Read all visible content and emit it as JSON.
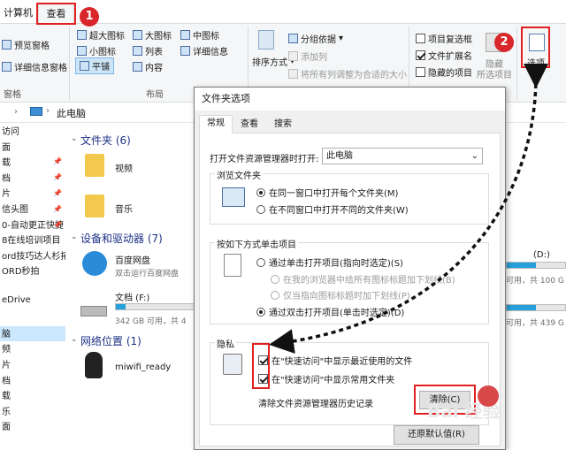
{
  "tabs": {
    "computer": "计算机",
    "view": "查看"
  },
  "markers": {
    "one": "1",
    "two": "2"
  },
  "ribbon": {
    "pane": {
      "preview": "预览窗格",
      "details": "详细信息窗格",
      "group": "窗格"
    },
    "layout": {
      "xl": "超大图标",
      "large": "大图标",
      "medium": "中图标",
      "small": "小图标",
      "list": "列表",
      "details": "详细信息",
      "tiles": "平铺",
      "content": "内容",
      "group": "布局"
    },
    "view": {
      "sort": "排序方式",
      "group_by": "分组依据",
      "add_col": "添加列",
      "fit": "将所有列调整为合适的大小"
    },
    "show": {
      "checkbox": "项目复选框",
      "ext": "文件扩展名",
      "hidden": "隐藏的项目",
      "hide": "隐藏",
      "selected": "所选项目"
    },
    "options": "选项"
  },
  "address": {
    "path": "此电脑"
  },
  "nav": [
    "访问",
    "面",
    "载",
    "档",
    "片",
    "信头图",
    "0-自动更正快捷",
    "8在线培训项目",
    "ord技巧达人杉拓",
    "ORD秒拍",
    "",
    "eDrive",
    "",
    "脑",
    "频",
    "片",
    "档",
    "载",
    "乐",
    "面"
  ],
  "content": {
    "folders_header": "文件夹 (6)",
    "folders": [
      "视频",
      "音乐"
    ],
    "drives_header": "设备和驱动器 (7)",
    "baidu": {
      "name": "百度网盘",
      "sub": "双击运行百度网盘"
    },
    "doc_drive": {
      "name": "文档 (F:)",
      "free": "342 GB 可用，共 4",
      "fill": 0.12
    },
    "right_drive": {
      "label": "(D:)",
      "free": "可用，共 100 G",
      "free2": "可用，共 439 G",
      "fill": 0.5
    },
    "network_header": "网络位置 (1)",
    "network": [
      "miwifi_ready"
    ]
  },
  "dialog": {
    "title": "文件夹选项",
    "tabs": [
      "常规",
      "查看",
      "搜索"
    ],
    "open_label": "打开文件资源管理器时打开:",
    "open_value": "此电脑",
    "browse": {
      "legend": "浏览文件夹",
      "same": "在同一窗口中打开每个文件夹(M)",
      "new": "在不同窗口中打开不同的文件夹(W)"
    },
    "click": {
      "legend": "按如下方式单击项目",
      "single": "通过单击打开项目(指向时选定)(S)",
      "browser": "在我的浏览器中给所有图标标题加下划线(B)",
      "point": "仅当指向图标标题时加下划线(P)",
      "double": "通过双击打开项目(单击时选定)(D)"
    },
    "privacy": {
      "legend": "隐私",
      "recent": "在\"快速访问\"中显示最近使用的文件",
      "frequent": "在\"快速访问\"中显示常用文件夹",
      "clear_label": "清除文件资源管理器历史记录",
      "clear_btn": "清除(C)"
    },
    "restore": "还原默认值(R)"
  },
  "watermark": "Bai 经验"
}
